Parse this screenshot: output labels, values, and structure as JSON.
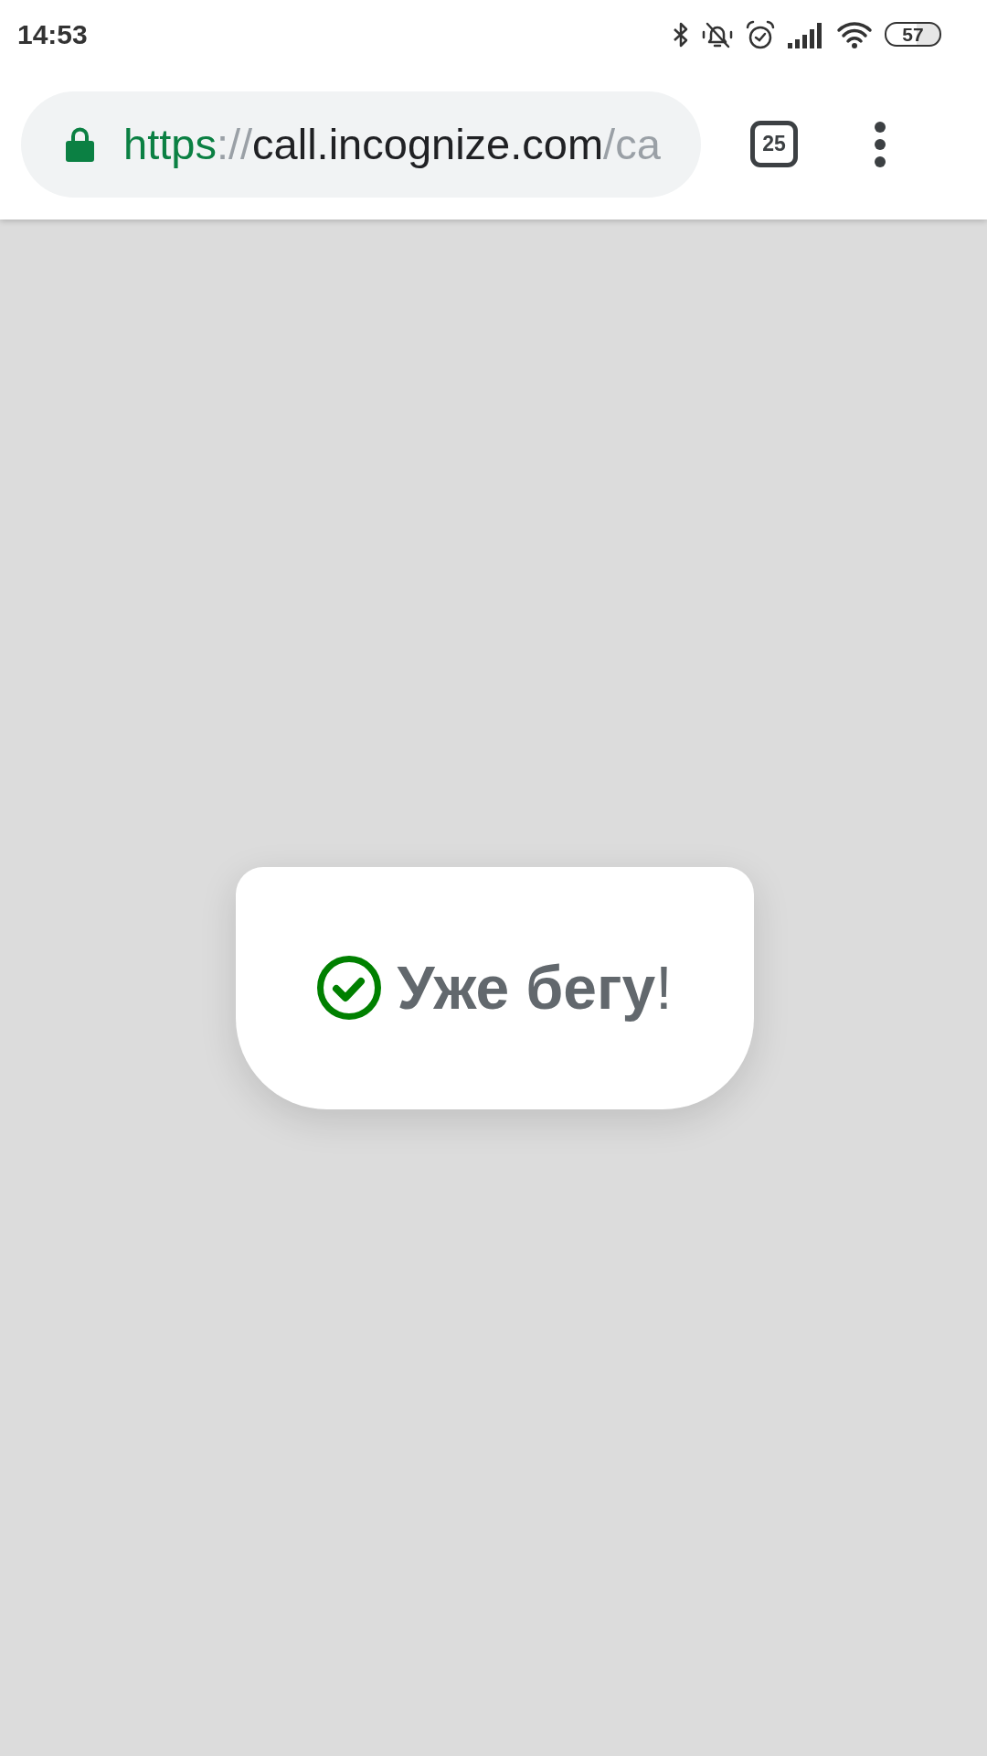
{
  "status_bar": {
    "time": "14:53",
    "battery": "57"
  },
  "toolbar": {
    "url": [
      {
        "kind": "scheme",
        "text": "https"
      },
      {
        "kind": "separator",
        "text": "://"
      },
      {
        "kind": "host",
        "text": "call.incognize.com"
      },
      {
        "kind": "path",
        "text": "/ca"
      }
    ],
    "tab_count": "25"
  },
  "toast": {
    "message": "**Уже бегу**!"
  }
}
